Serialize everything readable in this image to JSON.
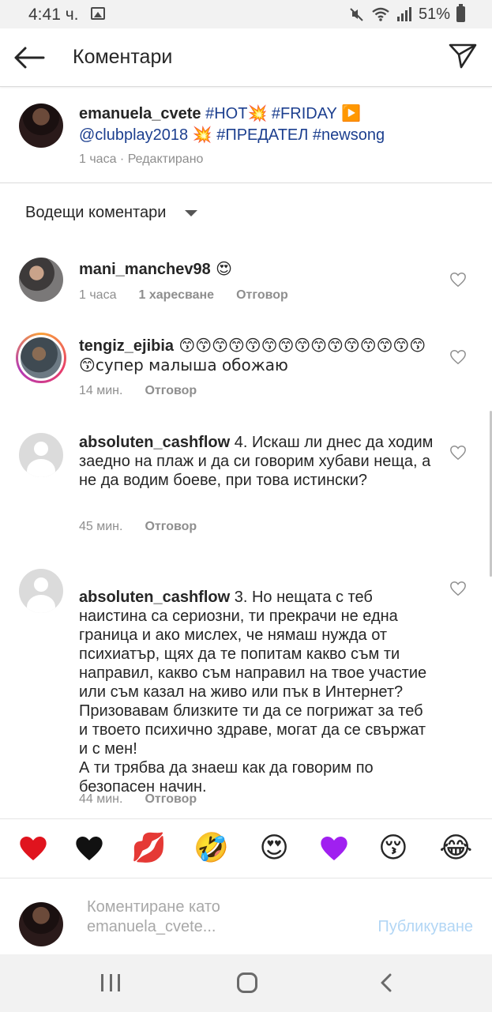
{
  "status_bar": {
    "time": "4:41 ч.",
    "battery": "51%"
  },
  "header": {
    "title": "Коментари"
  },
  "caption": {
    "username": "emanuela_cvete",
    "text_1": " #HOT",
    "emoji_1": "💥",
    "text_2": " #FRIDAY ",
    "emoji_2": "▶️",
    "text_3": " @clubplay2018 ",
    "emoji_3": "💥",
    "text_4": " #ПРЕДАТЕЛ #newsong",
    "meta": "1 часа · Редактирано"
  },
  "sort": {
    "label": "Водещи коментари"
  },
  "comments": [
    {
      "username": "mani_manchev98",
      "text": " 😍",
      "time": "1 часа",
      "likes": "1 харесване",
      "reply": "Отговор"
    },
    {
      "username": "tengiz_ejibia",
      "text": " 😙😙😙😙😙😙😙😙😙😙😙😙😙😙😙😙супер малыша обожаю",
      "time": "14 мин.",
      "reply": "Отговор"
    },
    {
      "username": "absoluten_cashflow",
      "text": " 4. Искаш ли днес да ходим заедно на плаж и да си говорим хубави неща, а не да водим боеве, при това истински?",
      "time": "45 мин.",
      "reply": "Отговор"
    },
    {
      "username": "absoluten_cashflow",
      "text": " 3. Но нещата с теб наистина са сериозни, ти прекрачи не една граница и ако мислех, че нямаш нужда от психиатър, щях да те попитам какво съм ти направил, какво съм направил на твое участие или съм казал на живо или пък в Интернет? Призовавам близките ти да се погрижат за теб и твоето психично здраве, могат да се свържат и с мен!\nА ти трябва да знаеш как да говорим по безопасен начин.",
      "time": "44 мин.",
      "reply": "Отговор"
    }
  ],
  "reactions": [
    "❤️",
    "🖤",
    "💋",
    "🤣",
    "😍",
    "💜",
    "😚",
    "😂"
  ],
  "reaction_icons": [
    "red-heart-icon",
    "black-heart-icon",
    "kiss-mark-icon",
    "rolling-laughing-icon",
    "heart-eyes-icon",
    "purple-heart-icon",
    "kissing-face-icon",
    "tears-of-joy-icon"
  ],
  "composer": {
    "placeholder": "Коментиране като emanuela_cvete...",
    "publish": "Публикуване"
  },
  "colors": {
    "link": "#1c3f8f",
    "publish_disabled": "#b2d6f5",
    "meta_gray": "#8e8e8e"
  }
}
